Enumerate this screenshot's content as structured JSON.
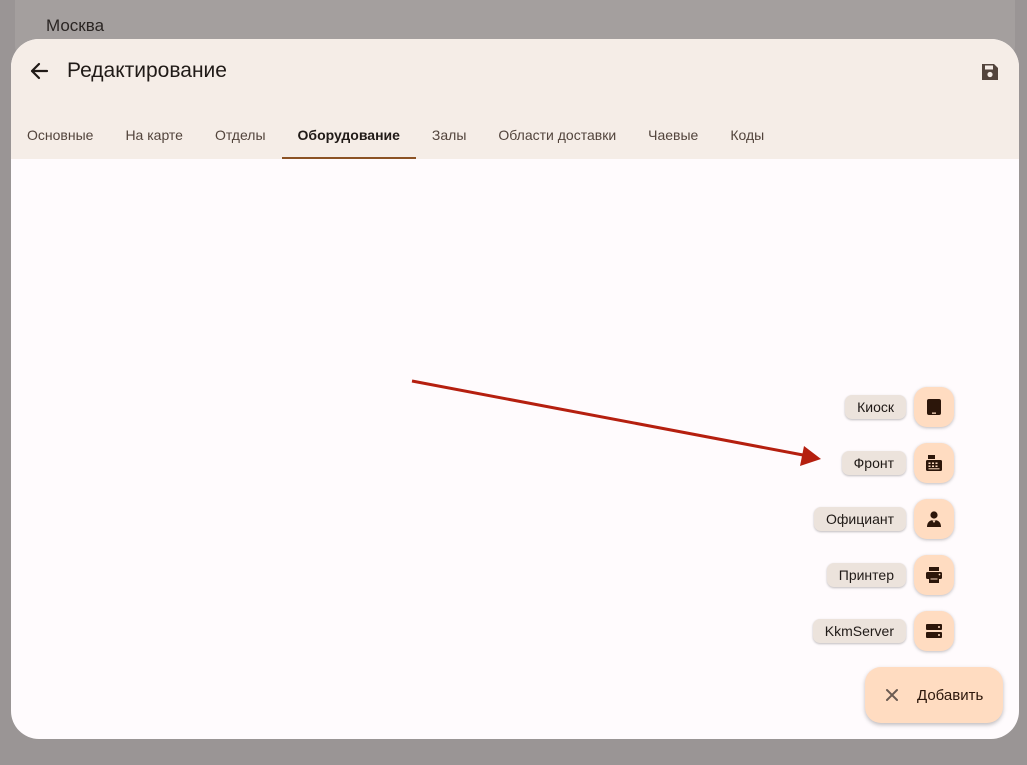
{
  "background": {
    "title": "Москва"
  },
  "dialog": {
    "title": "Редактирование",
    "tabs": [
      {
        "label": "Основные",
        "active": false
      },
      {
        "label": "На карте",
        "active": false
      },
      {
        "label": "Отделы",
        "active": false
      },
      {
        "label": "Оборудование",
        "active": true
      },
      {
        "label": "Залы",
        "active": false
      },
      {
        "label": "Области доставки",
        "active": false
      },
      {
        "label": "Чаевые",
        "active": false
      },
      {
        "label": "Коды",
        "active": false
      }
    ]
  },
  "speed_dial": {
    "items": [
      {
        "label": "Киоск",
        "icon": "tablet-icon"
      },
      {
        "label": "Фронт",
        "icon": "cash-register-icon"
      },
      {
        "label": "Официант",
        "icon": "waiter-icon"
      },
      {
        "label": "Принтер",
        "icon": "printer-icon"
      },
      {
        "label": "KkmServer",
        "icon": "server-icon"
      }
    ],
    "fab_label": "Добавить",
    "fab_icon": "close-icon"
  },
  "colors": {
    "accent": "#8b5224",
    "fab_bg": "#ffdcc1",
    "annotation_arrow": "#b51f0f"
  }
}
